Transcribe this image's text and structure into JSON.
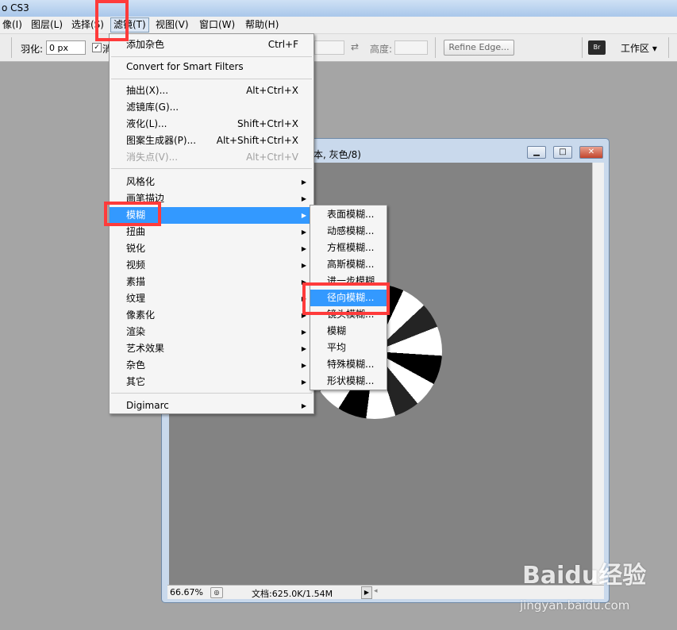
{
  "app_title": "o CS3",
  "menubar": [
    "像(I)",
    "图层(L)",
    "选择(S)",
    "滤镜(T)",
    "视图(V)",
    "窗口(W)",
    "帮助(H)"
  ],
  "options": {
    "feather_label": "羽化:",
    "feather_value": "0 px",
    "antialias_label": "消",
    "height_label": "高度:",
    "refine_edge": "Refine Edge...",
    "workspace": "工作区 ▾",
    "bridge_icon_text": "Br"
  },
  "document": {
    "title_fragment": "本, 灰色/8)",
    "zoom": "66.67%",
    "doc_info": "文档:625.0K/1.54M"
  },
  "filter_menu": {
    "last_filter": "添加杂色",
    "last_filter_shortcut": "Ctrl+F",
    "convert_smart": "Convert for Smart Filters",
    "items_group2": [
      {
        "label": "抽出(X)...",
        "shortcut": "Alt+Ctrl+X"
      },
      {
        "label": "滤镜库(G)...",
        "shortcut": ""
      },
      {
        "label": "液化(L)...",
        "shortcut": "Shift+Ctrl+X"
      },
      {
        "label": "图案生成器(P)...",
        "shortcut": "Alt+Shift+Ctrl+X"
      },
      {
        "label": "消失点(V)...",
        "shortcut": "Alt+Ctrl+V"
      }
    ],
    "submenus": [
      "风格化",
      "画笔描边",
      "模糊",
      "扭曲",
      "锐化",
      "视频",
      "素描",
      "纹理",
      "像素化",
      "渲染",
      "艺术效果",
      "杂色",
      "其它"
    ],
    "digimarc": "Digimarc"
  },
  "blur_submenu": [
    "表面模糊...",
    "动感模糊...",
    "方框模糊...",
    "高斯模糊...",
    "进一步模糊",
    "径向模糊...",
    "镜头模糊...",
    "模糊",
    "平均",
    "特殊模糊...",
    "形状模糊..."
  ],
  "watermark": {
    "brand": "Baidu经验",
    "url": "jingyan.baidu.com"
  },
  "colors": {
    "highlight": "#3399ff",
    "annotation": "#ff3b3b"
  }
}
